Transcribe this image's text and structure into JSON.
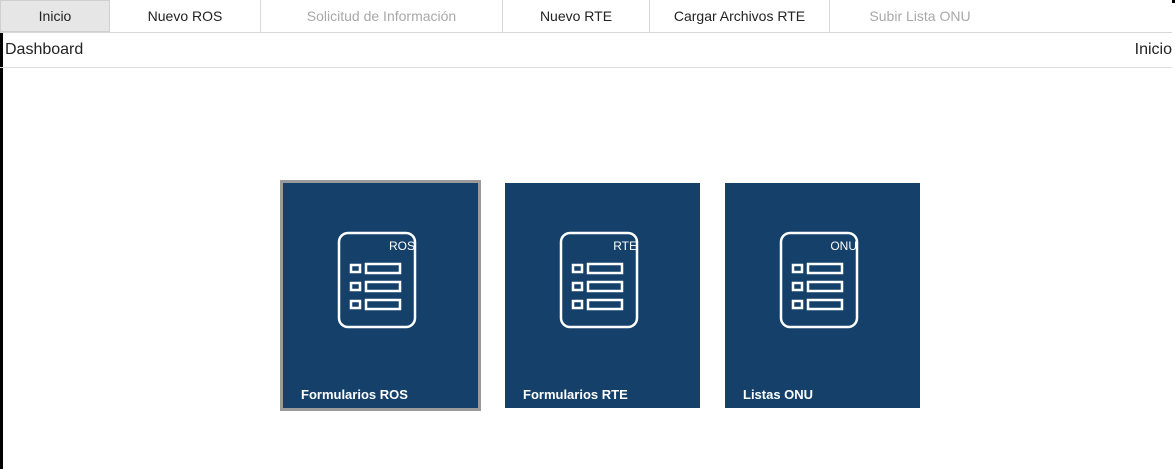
{
  "nav": {
    "tabs": [
      {
        "label": "Inicio",
        "state": "active"
      },
      {
        "label": "Nuevo ROS",
        "state": "normal"
      },
      {
        "label": "Solicitud de Información",
        "state": "disabled"
      },
      {
        "label": "Nuevo RTE",
        "state": "normal"
      },
      {
        "label": "Cargar Archivos RTE",
        "state": "normal"
      },
      {
        "label": "Subir Lista ONU",
        "state": "disabled"
      }
    ]
  },
  "breadcrumb": {
    "title": "Dashboard",
    "current": "Inicio"
  },
  "tiles": [
    {
      "tag": "ROS",
      "label": "Formularios ROS",
      "icon": "form-list-icon",
      "selected": true
    },
    {
      "tag": "RTE",
      "label": "Formularios RTE",
      "icon": "form-list-icon",
      "selected": false
    },
    {
      "tag": "ONU",
      "label": "Listas ONU",
      "icon": "form-list-icon",
      "selected": false
    }
  ],
  "colors": {
    "tile_bg": "#14406a",
    "tab_active_bg": "#e6e6e6",
    "tab_disabled_text": "#a8a8a8",
    "tile_selected_border": "#9a9a9a"
  }
}
